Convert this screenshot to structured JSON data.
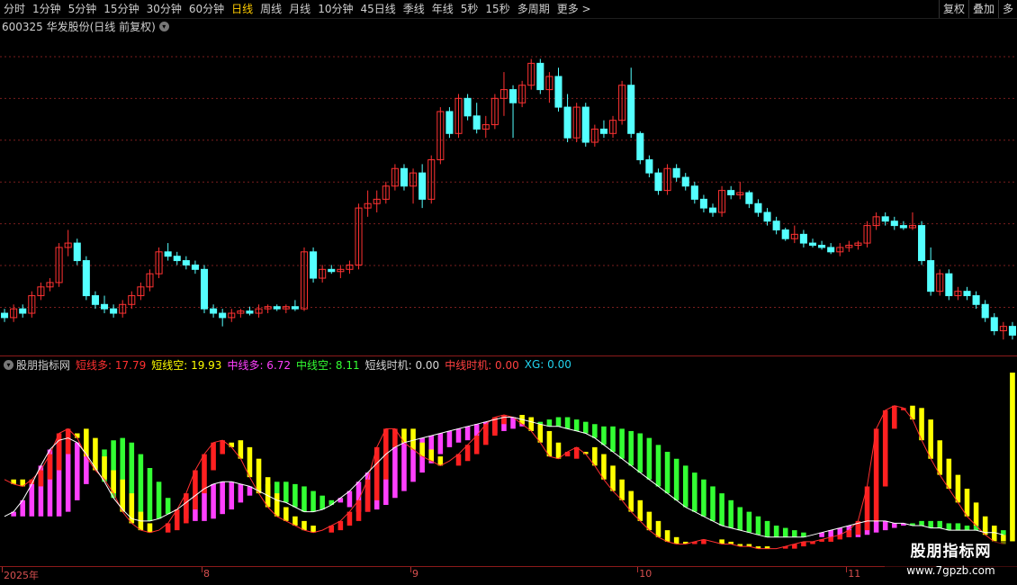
{
  "toolbar": {
    "tabs": [
      "分时",
      "1分钟",
      "5分钟",
      "15分钟",
      "30分钟",
      "60分钟",
      "日线",
      "周线",
      "月线",
      "10分钟",
      "45日线",
      "季线",
      "年线",
      "5秒",
      "15秒",
      "多周期",
      "更多 >"
    ],
    "active_tab": "日线",
    "right_buttons": [
      "复权",
      "叠加",
      "多"
    ]
  },
  "chart_title": "600325 华发股份(日线 前复权)",
  "indicator": {
    "name": "股朋指标网",
    "items": [
      {
        "label": "短线多: 17.79",
        "color": "#ff3030"
      },
      {
        "label": "短线空: 19.93",
        "color": "#ffff00"
      },
      {
        "label": "中线多: 6.72",
        "color": "#ff40ff"
      },
      {
        "label": "中线空: 8.11",
        "color": "#33ff33"
      },
      {
        "label": "短线时机: 0.00",
        "color": "#d8d8d8"
      },
      {
        "label": "中线时机: 0.00",
        "color": "#ff4040"
      },
      {
        "label": "XG: 0.00",
        "color": "#22d3ee"
      }
    ]
  },
  "time_axis": {
    "labels": [
      "2025年",
      "8",
      "9",
      "10",
      "11"
    ]
  },
  "watermark": {
    "line1": "股朋指标网",
    "line2": "www.7gpzb.com"
  },
  "colors": {
    "up": "#ff3232",
    "down": "#54ffff",
    "bg": "#000000",
    "grid": "#7a1e1e"
  },
  "chart_data": {
    "type": "candlestick",
    "candles": [
      [
        9.8,
        9.9,
        9.6,
        9.7
      ],
      [
        9.7,
        10,
        9.6,
        9.9
      ],
      [
        9.9,
        10,
        9.7,
        9.8
      ],
      [
        9.8,
        10.3,
        9.7,
        10.2
      ],
      [
        10.2,
        10.5,
        10.1,
        10.4
      ],
      [
        10.4,
        10.6,
        10.3,
        10.5
      ],
      [
        10.5,
        11.4,
        10.4,
        11.3
      ],
      [
        11.3,
        11.7,
        11.1,
        11.4
      ],
      [
        11.4,
        11.5,
        10.9,
        11.0
      ],
      [
        11,
        11.1,
        10.1,
        10.2
      ],
      [
        10.2,
        10.3,
        9.9,
        10.0
      ],
      [
        10.0,
        10.2,
        9.8,
        9.9
      ],
      [
        9.9,
        10,
        9.7,
        9.8
      ],
      [
        9.8,
        10.1,
        9.7,
        10.0
      ],
      [
        10,
        10.3,
        9.9,
        10.2
      ],
      [
        10.2,
        10.5,
        10.1,
        10.4
      ],
      [
        10.4,
        10.8,
        10.3,
        10.7
      ],
      [
        10.7,
        11.3,
        10.6,
        11.2
      ],
      [
        11.2,
        11.4,
        11.0,
        11.1
      ],
      [
        11.1,
        11.2,
        10.9,
        11.0
      ],
      [
        11,
        11.1,
        10.8,
        10.9
      ],
      [
        10.9,
        11.0,
        10.7,
        10.8
      ],
      [
        10.8,
        10.9,
        9.8,
        9.9
      ],
      [
        9.9,
        10.0,
        9.7,
        9.8
      ],
      [
        9.8,
        9.9,
        9.5,
        9.7
      ],
      [
        9.7,
        9.9,
        9.6,
        9.8
      ],
      [
        9.8,
        9.9,
        9.7,
        9.85
      ],
      [
        9.85,
        9.95,
        9.75,
        9.8
      ],
      [
        9.8,
        10.0,
        9.7,
        9.9
      ],
      [
        9.9,
        10.0,
        9.8,
        9.95
      ],
      [
        9.95,
        10.0,
        9.85,
        9.9
      ],
      [
        9.9,
        10.0,
        9.8,
        9.95
      ],
      [
        9.95,
        10.1,
        9.85,
        9.9
      ],
      [
        9.9,
        11.3,
        9.85,
        11.2
      ],
      [
        11.2,
        11.3,
        10.5,
        10.6
      ],
      [
        10.6,
        10.9,
        10.5,
        10.8
      ],
      [
        10.8,
        10.9,
        10.7,
        10.75
      ],
      [
        10.75,
        10.9,
        10.6,
        10.8
      ],
      [
        10.8,
        11.0,
        10.7,
        10.9
      ],
      [
        10.9,
        12.3,
        10.8,
        12.2
      ],
      [
        12.2,
        12.6,
        12.0,
        12.3
      ],
      [
        12.3,
        12.6,
        12.1,
        12.4
      ],
      [
        12.4,
        12.8,
        12.3,
        12.7
      ],
      [
        12.7,
        13.2,
        12.6,
        13.1
      ],
      [
        13.1,
        13.2,
        12.6,
        12.7
      ],
      [
        12.7,
        13.1,
        12.3,
        13.0
      ],
      [
        13.0,
        13.2,
        12.2,
        12.4
      ],
      [
        12.4,
        13.4,
        12.3,
        13.3
      ],
      [
        13.3,
        14.5,
        13.2,
        14.4
      ],
      [
        14.4,
        14.5,
        13.8,
        13.9
      ],
      [
        13.9,
        14.8,
        13.8,
        14.7
      ],
      [
        14.7,
        14.8,
        14.2,
        14.3
      ],
      [
        14.3,
        14.6,
        13.9,
        14.0
      ],
      [
        14.0,
        14.3,
        13.8,
        14.1
      ],
      [
        14.1,
        14.8,
        14.0,
        14.7
      ],
      [
        14.7,
        15.3,
        14.3,
        14.9
      ],
      [
        14.9,
        15.0,
        13.8,
        14.6
      ],
      [
        14.6,
        15.1,
        14.5,
        15.0
      ],
      [
        15.0,
        15.6,
        14.9,
        15.5
      ],
      [
        15.5,
        15.6,
        14.8,
        14.9
      ],
      [
        14.9,
        15.3,
        14.6,
        15.2
      ],
      [
        15.2,
        15.4,
        14.4,
        14.5
      ],
      [
        14.5,
        14.8,
        13.7,
        13.8
      ],
      [
        13.8,
        14.6,
        13.7,
        14.5
      ],
      [
        14.5,
        14.6,
        13.6,
        13.7
      ],
      [
        13.7,
        14.1,
        13.6,
        14.0
      ],
      [
        14.0,
        14.2,
        13.8,
        13.9
      ],
      [
        13.9,
        14.3,
        13.8,
        14.2
      ],
      [
        14.2,
        15.1,
        14.1,
        15.0
      ],
      [
        15.0,
        15.4,
        13.8,
        13.9
      ],
      [
        13.9,
        13.95,
        13.2,
        13.3
      ],
      [
        13.3,
        13.4,
        12.9,
        13.0
      ],
      [
        13.0,
        13.1,
        12.5,
        12.6
      ],
      [
        12.6,
        13.2,
        12.5,
        13.1
      ],
      [
        13.1,
        13.2,
        12.8,
        12.9
      ],
      [
        12.9,
        13.0,
        12.6,
        12.7
      ],
      [
        12.7,
        12.8,
        12.3,
        12.4
      ],
      [
        12.4,
        12.5,
        12.1,
        12.2
      ],
      [
        12.2,
        12.3,
        12.0,
        12.1
      ],
      [
        12.1,
        12.7,
        12.0,
        12.6
      ],
      [
        12.6,
        12.7,
        12.4,
        12.5
      ],
      [
        12.5,
        12.8,
        12.4,
        12.55
      ],
      [
        12.55,
        12.6,
        12.2,
        12.3
      ],
      [
        12.3,
        12.4,
        12.0,
        12.1
      ],
      [
        12.1,
        12.2,
        11.8,
        11.9
      ],
      [
        11.9,
        12.0,
        11.6,
        11.7
      ],
      [
        11.7,
        11.75,
        11.45,
        11.5
      ],
      [
        11.5,
        11.8,
        11.4,
        11.6
      ],
      [
        11.6,
        11.7,
        11.3,
        11.4
      ],
      [
        11.4,
        11.5,
        11.3,
        11.35
      ],
      [
        11.35,
        11.45,
        11.25,
        11.3
      ],
      [
        11.3,
        11.4,
        11.15,
        11.2
      ],
      [
        11.2,
        11.4,
        11.1,
        11.3
      ],
      [
        11.3,
        11.45,
        11.2,
        11.35
      ],
      [
        11.35,
        11.45,
        11.25,
        11.4
      ],
      [
        11.4,
        11.9,
        11.3,
        11.8
      ],
      [
        11.8,
        12.1,
        11.7,
        12.0
      ],
      [
        12.0,
        12.1,
        11.8,
        11.9
      ],
      [
        11.9,
        12.0,
        11.7,
        11.8
      ],
      [
        11.8,
        11.9,
        11.7,
        11.75
      ],
      [
        11.75,
        12.1,
        11.7,
        11.8
      ],
      [
        11.8,
        11.9,
        10.9,
        11.0
      ],
      [
        11.0,
        11.3,
        10.2,
        10.3
      ],
      [
        10.3,
        10.8,
        10.2,
        10.7
      ],
      [
        10.7,
        10.8,
        10.1,
        10.2
      ],
      [
        10.2,
        10.4,
        10.1,
        10.3
      ],
      [
        10.3,
        10.4,
        10.1,
        10.2
      ],
      [
        10.2,
        10.3,
        9.9,
        10.0
      ],
      [
        10.0,
        10.1,
        9.6,
        9.7
      ],
      [
        9.7,
        9.8,
        9.3,
        9.4
      ],
      [
        9.4,
        9.6,
        9.2,
        9.5
      ],
      [
        9.5,
        9.6,
        9.2,
        9.3
      ]
    ],
    "indicator_series": {
      "short_term": [
        36,
        34,
        33,
        36,
        40,
        47,
        56,
        58,
        54,
        46,
        40,
        36,
        30,
        22,
        17,
        14,
        13,
        14,
        17,
        23,
        30,
        40,
        47,
        52,
        53,
        50,
        45,
        37,
        30,
        24,
        20,
        18,
        16,
        14,
        13,
        14,
        16,
        18,
        22,
        27,
        36,
        50,
        58,
        58,
        52,
        49,
        46,
        44,
        42,
        44,
        47,
        51,
        55,
        60,
        63,
        64,
        63,
        60,
        57,
        52,
        46,
        45,
        48,
        50,
        47,
        42,
        36,
        31,
        27,
        22,
        18,
        14,
        11,
        9,
        8,
        8,
        9,
        10,
        9,
        8,
        8,
        7,
        7,
        6,
        6,
        6,
        7,
        8,
        9,
        9,
        10,
        11,
        12,
        14,
        18,
        33,
        58,
        66,
        68,
        67,
        62,
        53,
        45,
        38,
        32,
        26,
        20,
        16,
        12,
        9,
        8
      ],
      "medium_term": [
        20,
        22,
        27,
        34,
        42,
        49,
        53,
        54,
        52,
        47,
        41,
        35,
        28,
        23,
        19,
        18,
        18,
        19,
        21,
        23,
        26,
        29,
        32,
        34,
        35,
        35,
        34,
        33,
        31,
        29,
        27,
        26,
        24,
        22,
        22,
        23,
        25,
        28,
        31,
        35,
        39,
        43,
        47,
        50,
        52,
        53,
        54,
        55,
        56,
        57,
        58,
        59,
        60,
        61,
        62,
        63,
        63,
        62,
        61,
        60,
        59,
        59,
        58,
        57,
        56,
        54,
        51,
        48,
        45,
        42,
        39,
        36,
        33,
        30,
        27,
        24,
        22,
        20,
        18,
        16,
        15,
        14,
        13,
        12,
        11,
        11,
        11,
        11,
        11,
        12,
        13,
        14,
        15,
        16,
        17,
        18,
        18,
        18,
        17,
        17,
        16,
        16,
        15,
        15,
        14,
        14,
        14,
        14,
        13,
        13,
        12
      ]
    },
    "price_range": [
      9.0,
      16.0
    ],
    "indicator_range": [
      0,
      80
    ],
    "time_labels": [
      "2025年",
      "8",
      "9",
      "10",
      "11"
    ]
  }
}
